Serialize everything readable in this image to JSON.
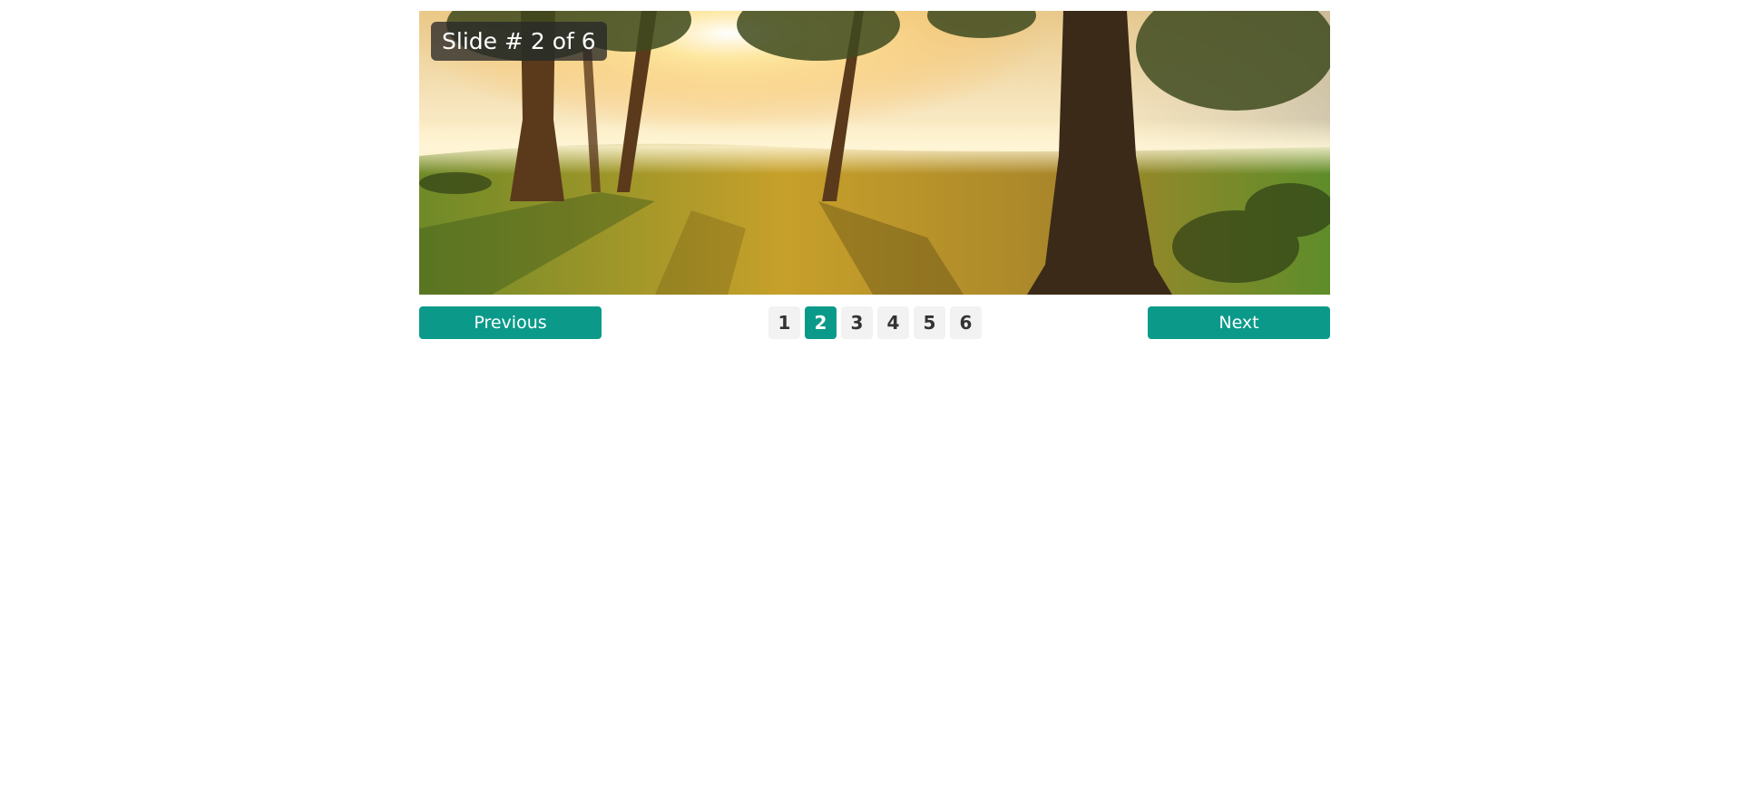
{
  "slider": {
    "counter_text": "Slide # 2 of 6",
    "previous_label": "Previous",
    "next_label": "Next",
    "pages": [
      "1",
      "2",
      "3",
      "4",
      "5",
      "6"
    ],
    "current_page": 2,
    "accent_color": "#0b9a8a",
    "slide_image": "sunlit-forest-meadow-image"
  }
}
